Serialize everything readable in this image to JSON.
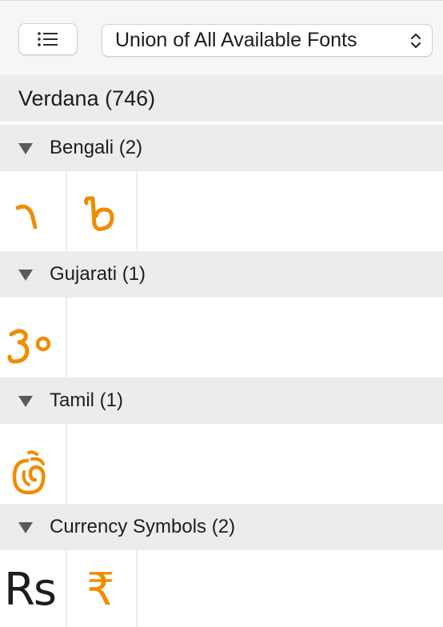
{
  "toolbar": {
    "list_button_icon": "list-icon",
    "collection_select": {
      "value": "Union of All Available Fonts",
      "icon": "chevron-updown-icon"
    }
  },
  "font": {
    "title": "Verdana (746)"
  },
  "sections": [
    {
      "label": "Bengali (2)",
      "glyphs": [
        "bengali-glyph-1",
        "bengali-glyph-2"
      ]
    },
    {
      "label": "Gujarati (1)",
      "glyphs": [
        "gujarati-glyph-1"
      ]
    },
    {
      "label": "Tamil (1)",
      "glyphs": [
        "tamil-glyph-1"
      ]
    },
    {
      "label": "Currency Symbols (2)",
      "glyphs": [
        "Rs",
        "₹"
      ]
    }
  ],
  "colors": {
    "glyph": "#f08c00",
    "header_bg": "#ececec",
    "toolbar_bg": "#f6f6f6"
  }
}
